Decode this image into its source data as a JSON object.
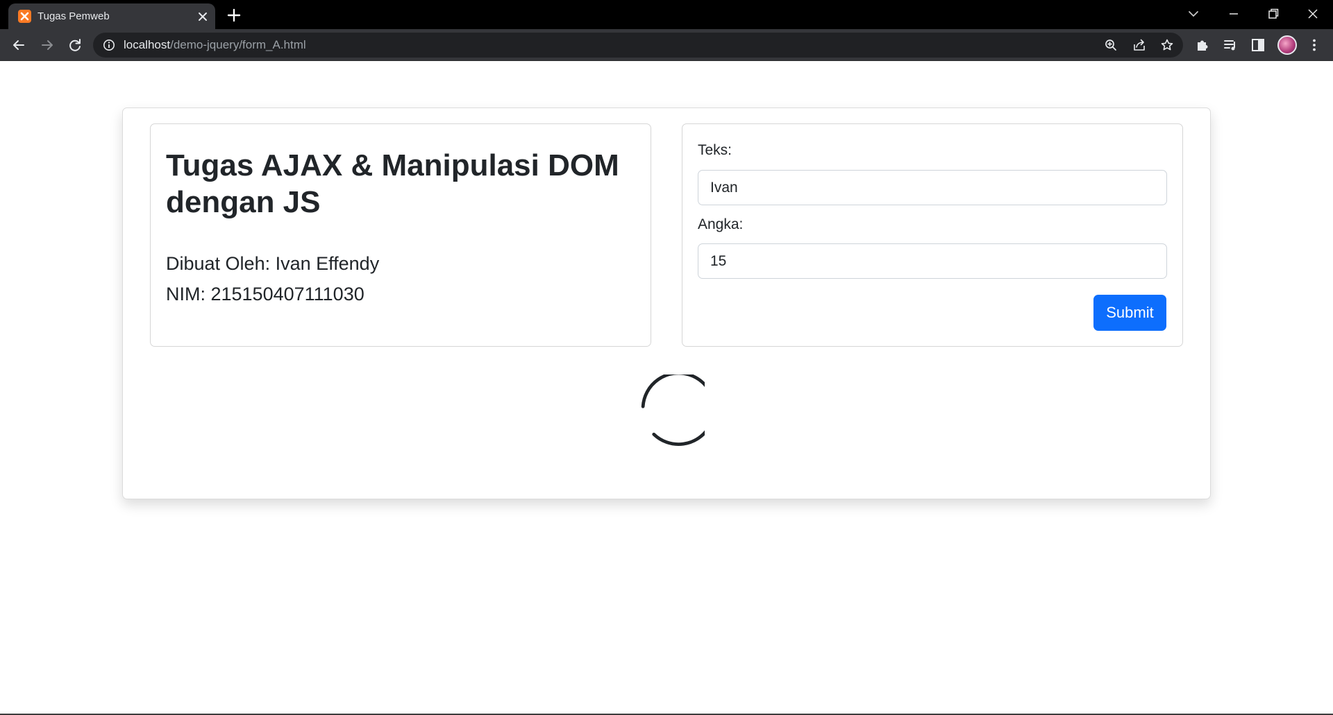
{
  "browser": {
    "tab_title": "Tugas Pemweb",
    "url_host": "localhost",
    "url_path": "/demo-jquery/form_A.html",
    "favicon": "xampp-icon"
  },
  "info": {
    "title": "Tugas AJAX & Manipulasi DOM dengan JS",
    "author": "Dibuat Oleh: Ivan Effendy",
    "nim": "NIM: 215150407111030"
  },
  "form": {
    "text_label": "Teks:",
    "text_value": "Ivan",
    "number_label": "Angka:",
    "number_value": "15",
    "submit_label": "Submit"
  },
  "colors": {
    "primary": "#0d6efd",
    "text": "#212529",
    "chrome_dark": "#35363a"
  },
  "status": {
    "loading_indicator": "spinner-icon"
  }
}
